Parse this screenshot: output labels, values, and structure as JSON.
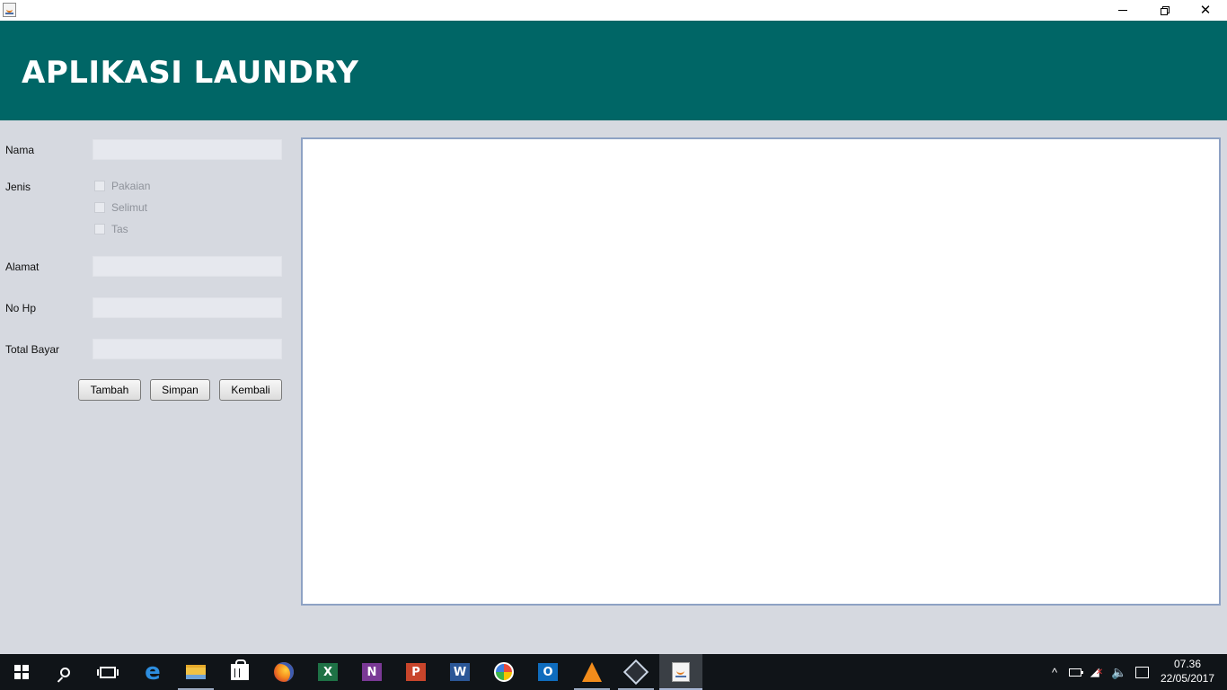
{
  "window": {
    "minimize_glyph": "",
    "close_glyph": "✕"
  },
  "header": {
    "title": "APLIKASI LAUNDRY"
  },
  "form": {
    "nama_label": "Nama",
    "jenis_label": "Jenis",
    "jenis_options": [
      "Pakaian",
      "Selimut",
      "Tas"
    ],
    "alamat_label": "Alamat",
    "nohp_label": "No Hp",
    "total_label": "Total Bayar",
    "nama_value": "",
    "alamat_value": "",
    "nohp_value": "",
    "total_value": ""
  },
  "buttons": {
    "tambah": "Tambah",
    "simpan": "Simpan",
    "kembali": "Kembali"
  },
  "output_area": {
    "content": ""
  },
  "taskbar": {
    "apps": [
      "start",
      "search",
      "task-view",
      "edge",
      "file-explorer",
      "store",
      "firefox",
      "excel",
      "onenote",
      "powerpoint",
      "word",
      "picasa",
      "outlook",
      "vlc",
      "netbeans",
      "java"
    ],
    "excel_letter": "X",
    "onenote_letter": "N",
    "powerpoint_letter": "P",
    "word_letter": "W",
    "outlook_letter": "O",
    "time": "07.36",
    "date": "22/05/2017"
  },
  "colors": {
    "header_bg": "#006666",
    "window_bg": "#d6d9e0",
    "textarea_border": "#8ea2c4",
    "taskbar_bg": "#101418"
  }
}
